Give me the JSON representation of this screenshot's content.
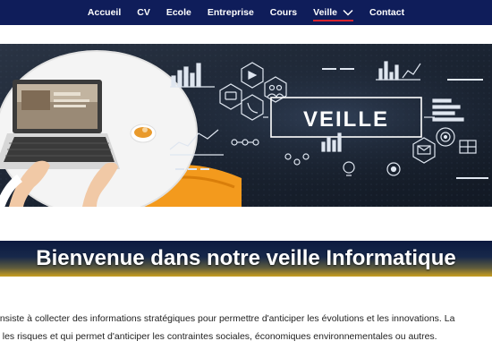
{
  "nav": {
    "items": [
      {
        "label": "Accueil",
        "active": false
      },
      {
        "label": "CV",
        "active": false
      },
      {
        "label": "Ecole",
        "active": false
      },
      {
        "label": "Entreprise",
        "active": false
      },
      {
        "label": "Cours",
        "active": false
      },
      {
        "label": "Veille",
        "active": true,
        "has_dropdown": true
      },
      {
        "label": "Contact",
        "active": false
      }
    ],
    "background": "#0f1d5a",
    "active_underline": "#d9232d"
  },
  "hero": {
    "headline": "VEILLE",
    "icons": [
      "laptop",
      "coffee-cup",
      "chart-icon",
      "video-icon",
      "users-icon",
      "target-icon",
      "lightbulb-icon",
      "gear-icon",
      "chat-icon"
    ]
  },
  "banner": {
    "title": "Bienvenue dans notre veille Informatique"
  },
  "description": {
    "line1": "onsiste à collecter des informations stratégiques pour permettre d'anticiper les évolutions et les innovations. La",
    "line2": "ir les risques et qui permet d'anticiper les contraintes sociales, économiques environnementales ou autres."
  }
}
